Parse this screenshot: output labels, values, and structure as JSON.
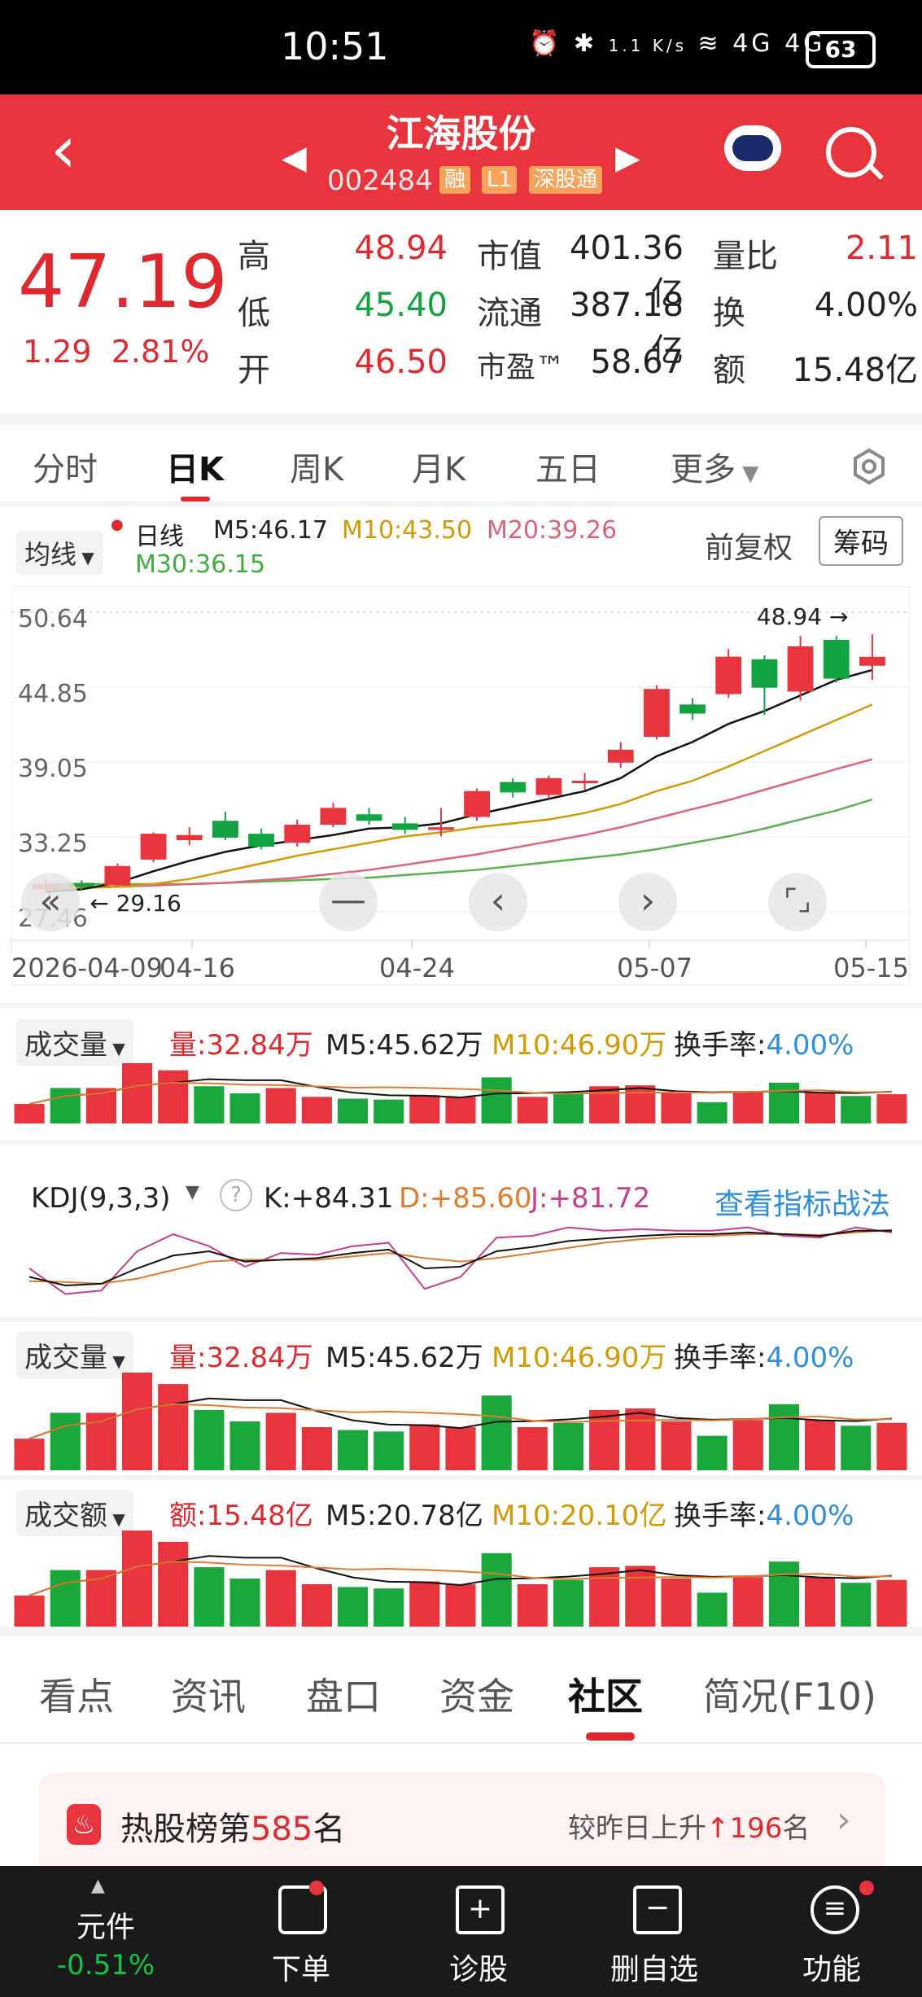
{
  "status": {
    "time": "10:51",
    "net_speed": "1.1 K/s",
    "signal": "4G 4G",
    "battery": "63"
  },
  "header": {
    "name": "江海股份",
    "code": "002484",
    "tags": [
      "融",
      "L1",
      "深股通"
    ]
  },
  "quote": {
    "price": "47.19",
    "change": "1.29",
    "change_pct": "2.81%",
    "items": [
      {
        "label": "高",
        "value": "48.94",
        "color": "red"
      },
      {
        "label": "低",
        "value": "45.40",
        "color": "green"
      },
      {
        "label": "开",
        "value": "46.50",
        "color": "red"
      }
    ],
    "items2": [
      {
        "label": "市值",
        "value": "401.36亿"
      },
      {
        "label": "流通",
        "value": "387.18亿"
      },
      {
        "label": "市盈™",
        "value": "58.67"
      }
    ],
    "items3": [
      {
        "label": "量比",
        "value": "2.11"
      },
      {
        "label": "换",
        "value": "4.00%"
      },
      {
        "label": "额",
        "value": "15.48亿"
      }
    ]
  },
  "ktabs": [
    "分时",
    "日K",
    "周K",
    "月K",
    "五日",
    "更多"
  ],
  "ma_legend": {
    "selector": "均线",
    "period": "日线",
    "m5": "M5:46.17",
    "m10": "M10:43.50",
    "m20": "M20:39.26",
    "m30": "M30:36.15",
    "fq": "前复权",
    "chips": "筹码"
  },
  "chart_data": {
    "type": "candlestick",
    "y_ticks": [
      "50.64",
      "44.85",
      "39.05",
      "33.25",
      "27.46"
    ],
    "x_ticks": [
      "2026-04-09",
      "04-16",
      "04-24",
      "05-07",
      "05-15"
    ],
    "high_label": "48.94",
    "low_label": "29.16",
    "ylim": [
      27.46,
      50.64
    ],
    "candles": [
      {
        "o": 29.2,
        "c": 29.6,
        "h": 30.0,
        "l": 29.2
      },
      {
        "o": 29.7,
        "c": 29.4,
        "h": 29.9,
        "l": 29.16
      },
      {
        "o": 29.5,
        "c": 31.0,
        "h": 31.2,
        "l": 29.4
      },
      {
        "o": 31.5,
        "c": 33.5,
        "h": 33.6,
        "l": 31.3
      },
      {
        "o": 33.0,
        "c": 33.4,
        "h": 34.0,
        "l": 32.6
      },
      {
        "o": 34.5,
        "c": 33.2,
        "h": 35.2,
        "l": 33.0
      },
      {
        "o": 33.5,
        "c": 32.5,
        "h": 33.9,
        "l": 32.3
      },
      {
        "o": 32.8,
        "c": 34.2,
        "h": 34.6,
        "l": 32.5
      },
      {
        "o": 34.2,
        "c": 35.5,
        "h": 35.9,
        "l": 34.0
      },
      {
        "o": 35.0,
        "c": 34.5,
        "h": 35.5,
        "l": 34.2
      },
      {
        "o": 34.3,
        "c": 33.8,
        "h": 34.8,
        "l": 33.5
      },
      {
        "o": 33.8,
        "c": 34.0,
        "h": 35.5,
        "l": 33.3
      },
      {
        "o": 34.8,
        "c": 36.8,
        "h": 37.0,
        "l": 34.5
      },
      {
        "o": 37.5,
        "c": 36.7,
        "h": 37.8,
        "l": 36.3
      },
      {
        "o": 36.5,
        "c": 37.8,
        "h": 38.0,
        "l": 36.2
      },
      {
        "o": 37.6,
        "c": 37.6,
        "h": 38.2,
        "l": 36.9
      },
      {
        "o": 39.0,
        "c": 40.0,
        "h": 40.6,
        "l": 38.6
      },
      {
        "o": 41.0,
        "c": 44.7,
        "h": 45.0,
        "l": 40.8
      },
      {
        "o": 43.5,
        "c": 42.8,
        "h": 44.0,
        "l": 42.3
      },
      {
        "o": 44.3,
        "c": 47.2,
        "h": 47.8,
        "l": 44.0
      },
      {
        "o": 47.0,
        "c": 44.8,
        "h": 47.3,
        "l": 42.7
      },
      {
        "o": 44.5,
        "c": 48.0,
        "h": 48.8,
        "l": 43.8
      },
      {
        "o": 48.5,
        "c": 45.5,
        "h": 48.8,
        "l": 45.2
      },
      {
        "o": 46.5,
        "c": 47.19,
        "h": 48.94,
        "l": 45.4
      }
    ],
    "ma5": [
      29.0,
      29.2,
      29.7,
      30.6,
      31.4,
      32.1,
      32.6,
      33.0,
      33.4,
      33.9,
      34.0,
      34.3,
      35.0,
      35.6,
      36.2,
      36.8,
      37.8,
      39.5,
      40.6,
      42.0,
      43.0,
      44.2,
      45.4,
      46.17
    ],
    "ma10": [
      29.2,
      29.3,
      29.4,
      29.6,
      30.0,
      30.6,
      31.2,
      31.8,
      32.3,
      32.8,
      33.3,
      33.6,
      34.0,
      34.3,
      34.6,
      35.1,
      35.8,
      36.8,
      37.6,
      38.7,
      39.9,
      41.1,
      42.3,
      43.5
    ],
    "ma20": [
      29.4,
      29.4,
      29.4,
      29.5,
      29.6,
      29.7,
      29.9,
      30.1,
      30.4,
      30.7,
      31.1,
      31.5,
      31.9,
      32.4,
      32.9,
      33.4,
      34.0,
      34.7,
      35.4,
      36.1,
      36.9,
      37.7,
      38.5,
      39.26
    ],
    "ma30": [
      29.6,
      29.6,
      29.6,
      29.6,
      29.6,
      29.7,
      29.8,
      29.9,
      30.0,
      30.1,
      30.3,
      30.5,
      30.7,
      31.0,
      31.3,
      31.6,
      31.9,
      32.3,
      32.8,
      33.3,
      33.9,
      34.6,
      35.3,
      36.15
    ]
  },
  "volume": {
    "label": "成交量",
    "val": "量:32.84万",
    "m5": "M5:45.62万",
    "m10": "M10:46.90万",
    "turnover_label": "换手率:",
    "turnover": "4.00%",
    "bars": [
      22,
      40,
      40,
      68,
      60,
      42,
      34,
      40,
      30,
      28,
      27,
      32,
      30,
      52,
      30,
      33,
      42,
      43,
      34,
      24,
      35,
      46,
      35,
      31,
      33
    ],
    "colors": [
      "r",
      "g",
      "r",
      "r",
      "r",
      "g",
      "g",
      "r",
      "r",
      "g",
      "g",
      "r",
      "r",
      "g",
      "r",
      "g",
      "r",
      "r",
      "r",
      "g",
      "r",
      "g",
      "r",
      "g",
      "r"
    ]
  },
  "kdj": {
    "label": "KDJ(9,3,3)",
    "k": "K:+84.31",
    "d": "D:+85.60",
    "j": "J:+81.72",
    "link": "查看指标战法"
  },
  "volume2": {
    "label": "成交量",
    "val": "量:32.84万",
    "m5": "M5:45.62万",
    "m10": "M10:46.90万",
    "turnover_label": "换手率:",
    "turnover": "4.00%"
  },
  "amount": {
    "label": "成交额",
    "val": "额:15.48亿",
    "m5": "M5:20.78亿",
    "m10": "M10:20.10亿",
    "turnover_label": "换手率:",
    "turnover": "4.00%"
  },
  "btabs": [
    "看点",
    "资讯",
    "盘口",
    "资金",
    "社区",
    "简况(F10)"
  ],
  "hot": {
    "prefix": "热股榜第",
    "rank": "585",
    "suffix": "名",
    "right_prefix": "较昨日上升",
    "up": "196",
    "right_suffix": "名"
  },
  "bnav": {
    "yuanjian": "元件",
    "yuanjian_pct": "-0.51%",
    "order": "下单",
    "diagnose": "诊股",
    "delete": "删自选",
    "function": "功能"
  }
}
